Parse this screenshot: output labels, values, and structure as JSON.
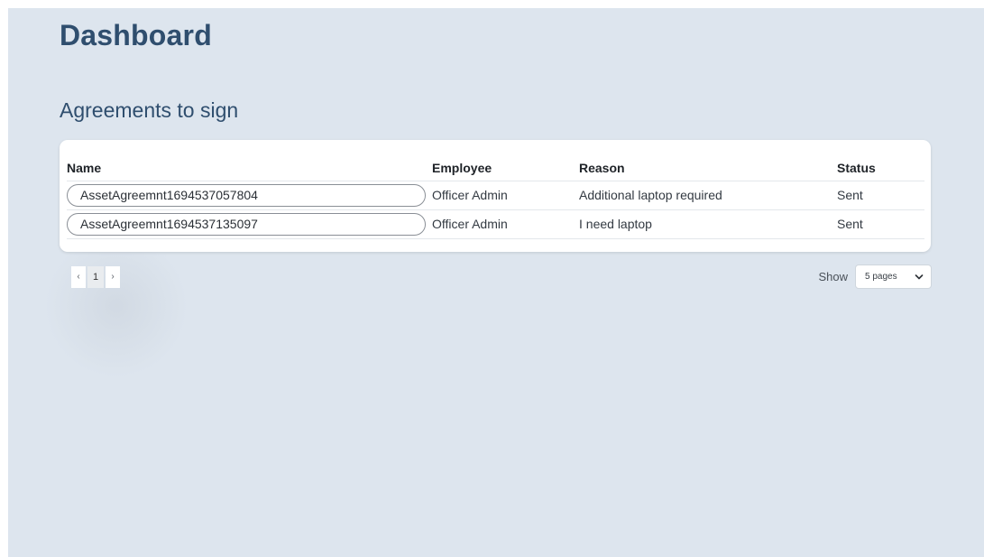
{
  "page": {
    "title": "Dashboard"
  },
  "agreements": {
    "section_title": "Agreements to sign",
    "columns": {
      "name": "Name",
      "employee": "Employee",
      "reason": "Reason",
      "status": "Status"
    },
    "rows": [
      {
        "name": "AssetAgreemnt1694537057804",
        "employee": "Officer Admin",
        "reason": "Additional laptop required",
        "status": "Sent"
      },
      {
        "name": "AssetAgreemnt1694537135097",
        "employee": "Officer Admin",
        "reason": "I need laptop",
        "status": "Sent"
      }
    ]
  },
  "pagination": {
    "prev": "‹",
    "current_page": "1",
    "next": "›"
  },
  "page_size": {
    "label": "Show",
    "selected": "5 pages",
    "icon": "chevron-down-icon"
  },
  "colors": {
    "background": "#dde5ee",
    "heading": "#2f4e6e",
    "card": "#ffffff"
  }
}
